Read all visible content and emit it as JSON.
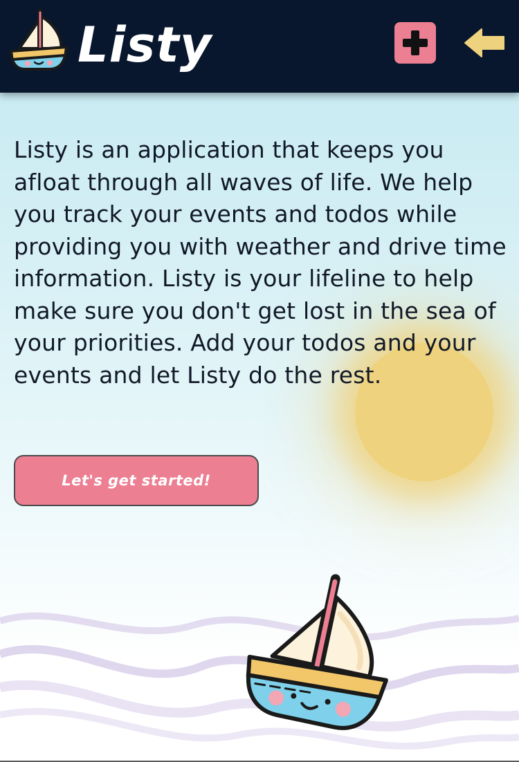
{
  "header": {
    "app_title": "Listy",
    "logo_icon": "sailboat-icon",
    "add_icon": "plus-icon",
    "back_icon": "arrow-left-icon"
  },
  "main": {
    "intro_text": "Listy is an application that keeps you afloat through all waves of life. We help you track your events and todos while providing you with weather and drive time information. Listy is your lifeline to help make sure you don't get lost in the sea of your priorities. Add your todos and your events and let Listy do the rest.",
    "cta_label": "Let's get started!"
  },
  "colors": {
    "header_bg": "#08172d",
    "accent_pink": "#ec7f92",
    "sun_yellow": "#efd27e",
    "sky_light_blue": "#c9ebf2"
  }
}
